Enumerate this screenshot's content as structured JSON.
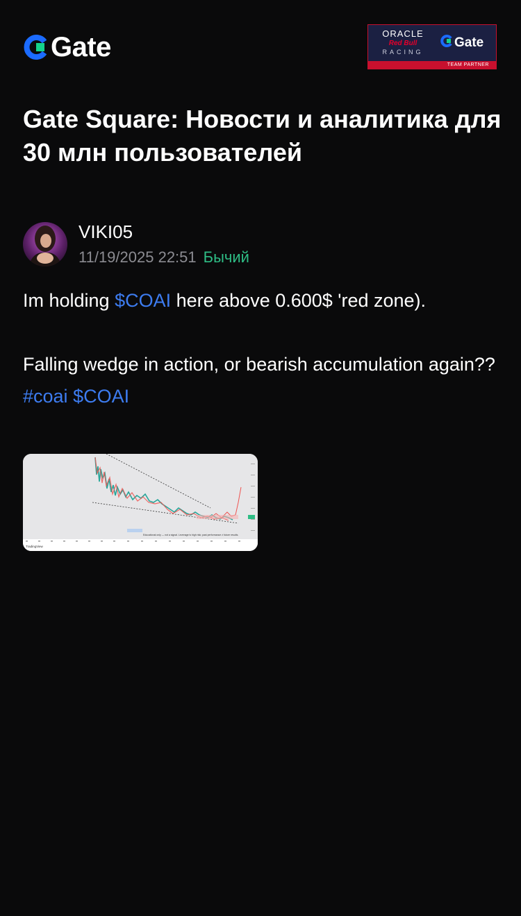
{
  "brand": {
    "name": "Gate",
    "accent": "#0d6efd",
    "partner": {
      "line1": "ORACLE",
      "line2": "Red Bull",
      "line3": "RACING",
      "brand": "Gate",
      "tag": "TEAM PARTNER"
    }
  },
  "headline": "Gate Square: Новости и аналитика для 30 млн пользователей",
  "post": {
    "author": "VIKI05",
    "timestamp": "11/19/2025 22:51",
    "sentiment": "Бычий",
    "sentiment_color": "#2ebd85",
    "line1": {
      "pre": "Im holding ",
      "ticker": "$COAI",
      "post": " here above 0.600$ 'red zone)."
    },
    "line2": "Falling wedge in action, or bearish accumulation again??",
    "tags": {
      "hashtag": "#coai",
      "ticker": "$COAI"
    },
    "attachment": {
      "type": "chart-screenshot",
      "watermark": "TradingView",
      "note": "Educational only — not a signal. Leverage is high risk; past performance ≠ future results."
    }
  }
}
